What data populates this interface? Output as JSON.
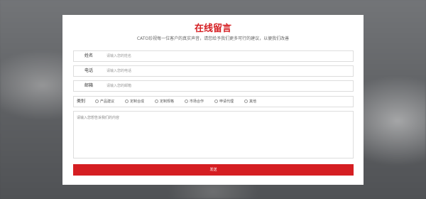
{
  "form": {
    "title": "在线留言",
    "subtitle": "CATO珍视每一位客户的真实声音，请您给予我们更多可行的建议，以便我们改善",
    "fields": [
      {
        "label": "姓名",
        "placeholder": "请输入您的姓名"
      },
      {
        "label": "电话",
        "placeholder": "请输入您的电话"
      },
      {
        "label": "邮箱",
        "placeholder": "请输入您的邮箱"
      }
    ],
    "type_label": "类别",
    "options": [
      "产品建议",
      "定制合成",
      "定制规格",
      "市场合作",
      "申请代理",
      "其他"
    ],
    "message_placeholder": "请输入您想告诉我们的内容",
    "submit_label": "发送"
  },
  "colors": {
    "accent": "#d51e22",
    "border": "#dddddd"
  }
}
